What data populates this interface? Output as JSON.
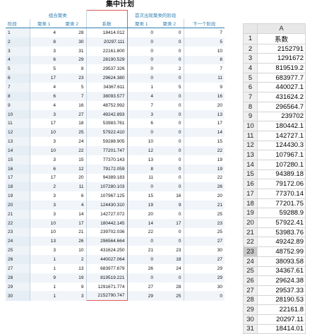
{
  "title": "集中计划",
  "left_table": {
    "group_headers": {
      "merged_cluster": "组合聚类",
      "first_appearance": "首次出现聚类的阶段"
    },
    "columns": [
      "阶段",
      "聚类 1",
      "聚类 2",
      "系数",
      "聚类 1",
      "聚类 2",
      "下一个阶段"
    ],
    "rows": [
      [
        "1",
        "4",
        "28",
        "18414.012",
        "0",
        "0",
        "7"
      ],
      [
        "2",
        "8",
        "30",
        "20297.111",
        "0",
        "0",
        "5"
      ],
      [
        "3",
        "3",
        "31",
        "22161.800",
        "0",
        "0",
        "10"
      ],
      [
        "4",
        "6",
        "29",
        "28190.529",
        "0",
        "0",
        "8"
      ],
      [
        "5",
        "5",
        "8",
        "29537.326",
        "0",
        "2",
        "7"
      ],
      [
        "6",
        "17",
        "23",
        "29624.380",
        "0",
        "0",
        "11"
      ],
      [
        "7",
        "4",
        "5",
        "34367.611",
        "1",
        "5",
        "9"
      ],
      [
        "8",
        "6",
        "7",
        "38093.577",
        "4",
        "0",
        "16"
      ],
      [
        "9",
        "4",
        "16",
        "48752.992",
        "7",
        "0",
        "20"
      ],
      [
        "10",
        "3",
        "27",
        "49242.893",
        "3",
        "0",
        "13"
      ],
      [
        "11",
        "17",
        "18",
        "53983.761",
        "6",
        "0",
        "17"
      ],
      [
        "12",
        "10",
        "25",
        "57922.410",
        "0",
        "0",
        "14"
      ],
      [
        "13",
        "3",
        "24",
        "59288.905",
        "10",
        "0",
        "15"
      ],
      [
        "14",
        "10",
        "22",
        "77201.747",
        "12",
        "0",
        "22"
      ],
      [
        "15",
        "3",
        "15",
        "77370.143",
        "13",
        "0",
        "19"
      ],
      [
        "16",
        "6",
        "12",
        "79172.059",
        "8",
        "0",
        "19"
      ],
      [
        "17",
        "17",
        "20",
        "94389.183",
        "11",
        "0",
        "22"
      ],
      [
        "18",
        "2",
        "11",
        "107280.103",
        "0",
        "0",
        "26"
      ],
      [
        "19",
        "3",
        "6",
        "107967.125",
        "15",
        "16",
        "20"
      ],
      [
        "20",
        "3",
        "4",
        "124430.310",
        "19",
        "9",
        "21"
      ],
      [
        "21",
        "3",
        "14",
        "142727.072",
        "20",
        "0",
        "25"
      ],
      [
        "22",
        "10",
        "17",
        "180442.145",
        "14",
        "17",
        "23"
      ],
      [
        "23",
        "10",
        "21",
        "239702.036",
        "22",
        "0",
        "25"
      ],
      [
        "24",
        "13",
        "26",
        "296564.664",
        "0",
        "0",
        "27"
      ],
      [
        "25",
        "3",
        "10",
        "431624.250",
        "21",
        "23",
        "30"
      ],
      [
        "26",
        "1",
        "2",
        "440027.064",
        "0",
        "18",
        "27"
      ],
      [
        "27",
        "1",
        "13",
        "683977.679",
        "26",
        "24",
        "29"
      ],
      [
        "28",
        "9",
        "19",
        "819519.221",
        "0",
        "0",
        "29"
      ],
      [
        "29",
        "1",
        "9",
        "1291671.774",
        "27",
        "28",
        "30"
      ],
      [
        "30",
        "1",
        "3",
        "2152790.747",
        "29",
        "25",
        "0"
      ]
    ]
  },
  "spreadsheet": {
    "column_letter": "A",
    "header_text": "系数",
    "selected_row": "23",
    "rows": [
      [
        "2",
        "2152791"
      ],
      [
        "3",
        "1291672"
      ],
      [
        "4",
        "819519.2"
      ],
      [
        "5",
        "683977.7"
      ],
      [
        "6",
        "440027.1"
      ],
      [
        "7",
        "431624.2"
      ],
      [
        "8",
        "296564.7"
      ],
      [
        "9",
        "239702"
      ],
      [
        "10",
        "180442.1"
      ],
      [
        "11",
        "142727.1"
      ],
      [
        "12",
        "124430.3"
      ],
      [
        "13",
        "107967.1"
      ],
      [
        "14",
        "107280.1"
      ],
      [
        "15",
        "94389.18"
      ],
      [
        "16",
        "79172.06"
      ],
      [
        "17",
        "77370.14"
      ],
      [
        "18",
        "77201.75"
      ],
      [
        "19",
        "59288.9"
      ],
      [
        "20",
        "57922.41"
      ],
      [
        "21",
        "53983.76"
      ],
      [
        "22",
        "49242.89"
      ],
      [
        "23",
        "48752.99"
      ],
      [
        "24",
        "38093.58"
      ],
      [
        "25",
        "34367.61"
      ],
      [
        "26",
        "29624.38"
      ],
      [
        "27",
        "29537.33"
      ],
      [
        "28",
        "28190.53"
      ],
      [
        "29",
        "22161.8"
      ],
      [
        "30",
        "20297.11"
      ],
      [
        "31",
        "18414.01"
      ]
    ]
  }
}
